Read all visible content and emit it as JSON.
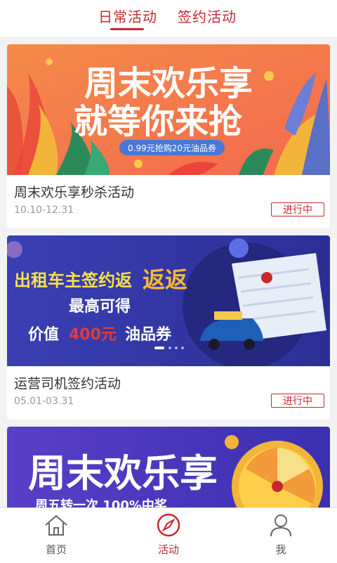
{
  "tabs": {
    "active": "日常活动",
    "inactive": "签约活动"
  },
  "cards": [
    {
      "banner": {
        "line1": "周末欢乐享",
        "line2": "就等你来抢",
        "tag": "0.99元抢购20元油品券"
      },
      "title": "周末欢乐享秒杀活动",
      "date": "10.10-12.31",
      "status": "进行中"
    },
    {
      "banner": {
        "line1a": "出租车主签约返",
        "line1b": "返返",
        "line2": "最高可得",
        "line3a": "价值",
        "line3b": "400元",
        "line3c": "油品券"
      },
      "title": "运营司机签约活动",
      "date": "05.01-03.31",
      "status": "进行中"
    },
    {
      "banner": {
        "line1": "周末欢乐享",
        "line2": "周五转一次 100%中奖"
      }
    }
  ],
  "nav": {
    "home": "首页",
    "activity": "活动",
    "me": "我"
  },
  "colors": {
    "accent": "#c8282d",
    "inactive_nav": "#555555"
  }
}
